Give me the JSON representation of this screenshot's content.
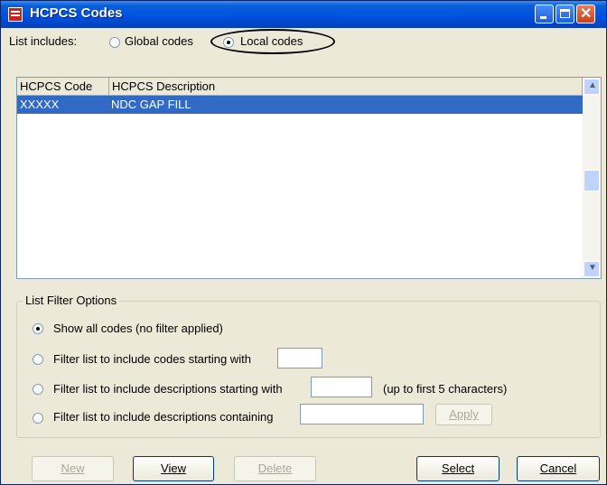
{
  "window": {
    "title": "HCPCS Codes"
  },
  "list_includes": {
    "label": "List includes:",
    "options": [
      {
        "label": "Global codes",
        "selected": false
      },
      {
        "label": "Local codes",
        "selected": true
      }
    ]
  },
  "table": {
    "columns": [
      "HCPCS Code",
      "HCPCS Description"
    ],
    "rows": [
      {
        "code": "XXXXX",
        "description": "NDC GAP FILL",
        "selected": true
      }
    ]
  },
  "filter": {
    "legend": "List Filter Options",
    "options": [
      {
        "label": "Show all codes (no filter applied)",
        "selected": true
      },
      {
        "label": "Filter list to include codes starting with",
        "selected": false
      },
      {
        "label": "Filter list to include descriptions starting with",
        "selected": false,
        "hint": "(up to first 5 characters)"
      },
      {
        "label": "Filter list to include descriptions containing",
        "selected": false
      }
    ],
    "codes_value": "",
    "desc_start_value": "",
    "desc_contains_value": "",
    "apply_label": "Apply"
  },
  "buttons": {
    "new": "New",
    "view": "View",
    "delete": "Delete",
    "select": "Select",
    "cancel": "Cancel"
  }
}
